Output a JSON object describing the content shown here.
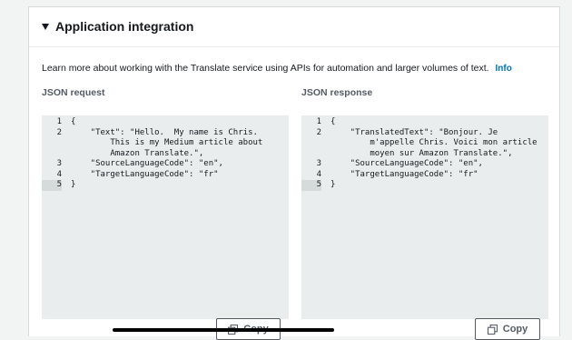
{
  "section": {
    "title": "Application integration",
    "description": "Learn more about working with the Translate service using APIs for automation and larger volumes of text.",
    "info_link": "Info"
  },
  "request": {
    "label": "JSON request",
    "lines": [
      {
        "num": "1",
        "text": "{"
      },
      {
        "num": "2",
        "text": "    \"Text\": \"Hello.  My name is Chris."
      },
      {
        "num": "",
        "text": "        This is my Medium article about"
      },
      {
        "num": "",
        "text": "        Amazon Translate.\","
      },
      {
        "num": "3",
        "text": "    \"SourceLanguageCode\": \"en\","
      },
      {
        "num": "4",
        "text": "    \"TargetLanguageCode\": \"fr\""
      },
      {
        "num": "5",
        "text": "}"
      }
    ],
    "copy_label": "Copy"
  },
  "response": {
    "label": "JSON response",
    "lines": [
      {
        "num": "1",
        "text": "{"
      },
      {
        "num": "2",
        "text": "    \"TranslatedText\": \"Bonjour. Je"
      },
      {
        "num": "",
        "text": "        m'appelle Chris. Voici mon article"
      },
      {
        "num": "",
        "text": "        moyen sur Amazon Translate.\","
      },
      {
        "num": "3",
        "text": "    \"SourceLanguageCode\": \"en\","
      },
      {
        "num": "4",
        "text": "    \"TargetLanguageCode\": \"fr\""
      },
      {
        "num": "5",
        "text": "}"
      }
    ],
    "copy_label": "Copy"
  },
  "icons": {
    "expand": "caret-down-icon",
    "copy": "copy-icon"
  },
  "colors": {
    "info_link": "#0073bb",
    "code_bg": "#eaeded",
    "active_line": "#d5dbdb"
  }
}
